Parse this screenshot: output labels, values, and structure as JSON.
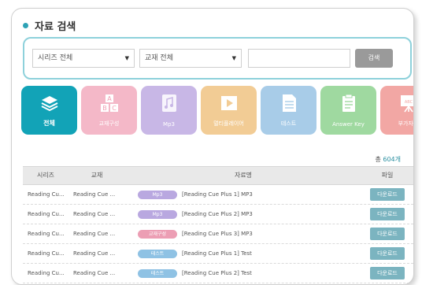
{
  "section": {
    "title": "자료 검색"
  },
  "search": {
    "series_select": "시리즈 전체",
    "book_select": "교재 전체",
    "keyword": "",
    "button_label": "검색"
  },
  "categories": [
    {
      "label": "전체",
      "icon": "stack-icon",
      "color": "#12a3b7"
    },
    {
      "label": "교재구성",
      "icon": "abc-blocks-icon",
      "color": "#f4b8c8"
    },
    {
      "label": "Mp3",
      "icon": "music-note-icon",
      "color": "#c8b7e6"
    },
    {
      "label": "멀티플레이어",
      "icon": "play-icon",
      "color": "#f2cc95"
    },
    {
      "label": "테스트",
      "icon": "test-sheet-icon",
      "color": "#a8cce8"
    },
    {
      "label": "Answer Key",
      "icon": "clipboard-icon",
      "color": "#9fd9a0"
    },
    {
      "label": "부가자료",
      "icon": "easel-icon",
      "color": "#f2a7a4"
    }
  ],
  "result": {
    "prefix": "총",
    "count": "604개"
  },
  "table": {
    "headers": [
      "시리즈",
      "교재",
      "자료명",
      "파일"
    ],
    "rows": [
      {
        "series": "Reading Cu...",
        "book": "Reading Cue ...",
        "type": "Mp3",
        "type_color": "#b9a8e0",
        "name": "[Reading Cue Plus 1] MP3",
        "download": "다운로드"
      },
      {
        "series": "Reading Cu...",
        "book": "Reading Cue ...",
        "type": "Mp3",
        "type_color": "#b9a8e0",
        "name": "[Reading Cue Plus 2] MP3",
        "download": "다운로드"
      },
      {
        "series": "Reading Cu...",
        "book": "Reading Cue ...",
        "type": "교재구성",
        "type_color": "#ec9eb4",
        "name": "[Reading Cue Plus 3] MP3",
        "download": "다운로드"
      },
      {
        "series": "Reading Cu...",
        "book": "Reading Cue ...",
        "type": "테스트",
        "type_color": "#8fc2e4",
        "name": "[Reading Cue Plus 1] Test",
        "download": "다운로드"
      },
      {
        "series": "Reading Cu...",
        "book": "Reading Cue ...",
        "type": "테스트",
        "type_color": "#8fc2e4",
        "name": "[Reading Cue Plus 2] Test",
        "download": "다운로드"
      }
    ]
  }
}
